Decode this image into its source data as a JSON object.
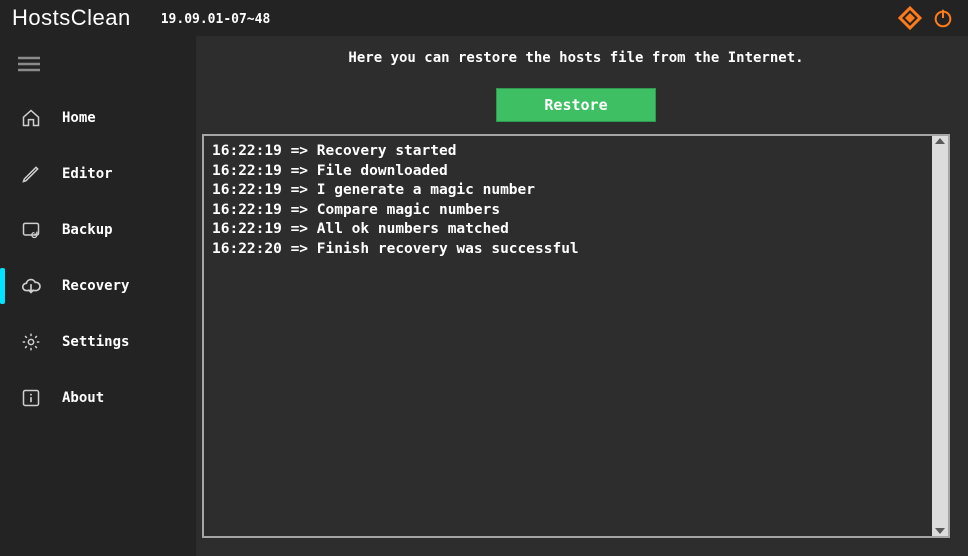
{
  "header": {
    "app_title": "HostsClean",
    "version": "19.09.01-07~48"
  },
  "sidebar": {
    "items": [
      {
        "label": "Home",
        "icon": "home-icon",
        "active": false
      },
      {
        "label": "Editor",
        "icon": "pencil-icon",
        "active": false
      },
      {
        "label": "Backup",
        "icon": "backup-icon",
        "active": false
      },
      {
        "label": "Recovery",
        "icon": "cloud-icon",
        "active": true
      },
      {
        "label": "Settings",
        "icon": "gear-icon",
        "active": false
      },
      {
        "label": "About",
        "icon": "info-icon",
        "active": false
      }
    ]
  },
  "main": {
    "description": "Here you can restore the hosts file from the Internet.",
    "restore_button": "Restore",
    "log": [
      {
        "time": "16:22:19",
        "msg": "Recovery started"
      },
      {
        "time": "16:22:19",
        "msg": "File downloaded"
      },
      {
        "time": "16:22:19",
        "msg": "I generate a magic number"
      },
      {
        "time": "16:22:19",
        "msg": "Compare magic numbers"
      },
      {
        "time": "16:22:19",
        "msg": "All ok numbers matched"
      },
      {
        "time": "16:22:20",
        "msg": "Finish recovery was successful"
      }
    ]
  },
  "colors": {
    "accent": "#00e5ff",
    "button": "#3fbf63",
    "brand_icon": "#ff7a1a"
  }
}
